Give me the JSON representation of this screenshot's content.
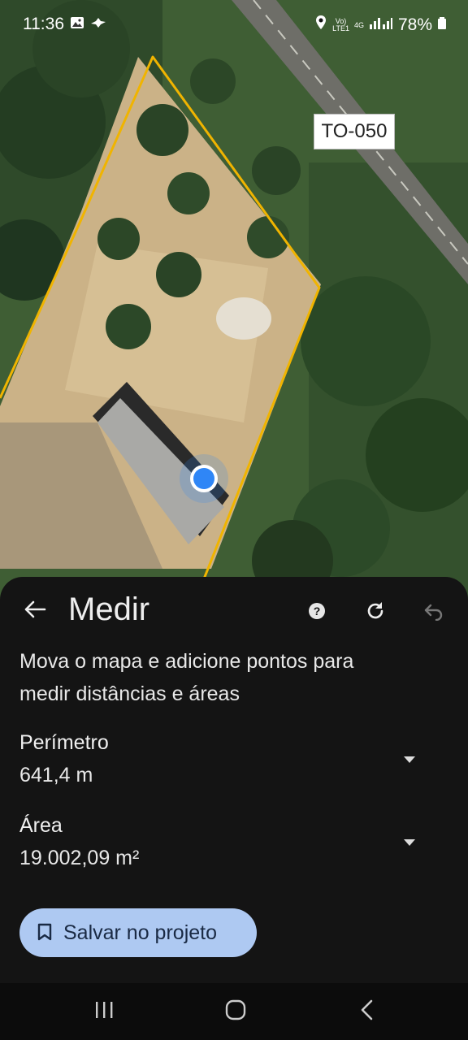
{
  "status_bar": {
    "time": "11:36",
    "network_top": "Vo)",
    "network_bottom": "LTE1",
    "network_type": "4G",
    "battery": "78%"
  },
  "map": {
    "road_label": "TO-050"
  },
  "sheet": {
    "title": "Medir",
    "instruction": "Mova o mapa e adicione pontos para medir distâncias e áreas",
    "perimeter_label": "Perímetro",
    "perimeter_value": "641,4 m",
    "area_label": "Área",
    "area_value": "19.002,09 m²",
    "save_button": "Salvar no projeto"
  },
  "icons": [
    "picture-icon",
    "cloud-icon",
    "location-icon",
    "signal-icon",
    "battery-icon",
    "back-arrow-icon",
    "help-icon",
    "refresh-icon",
    "undo-icon",
    "dropdown-arrow-icon",
    "bookmark-icon",
    "recents-icon",
    "home-icon",
    "nav-back-icon"
  ],
  "colors": {
    "measure_line": "#f0b400",
    "location_dot": "#2f86f6",
    "save_button_bg": "#aec9f2",
    "sheet_bg": "#141414"
  }
}
